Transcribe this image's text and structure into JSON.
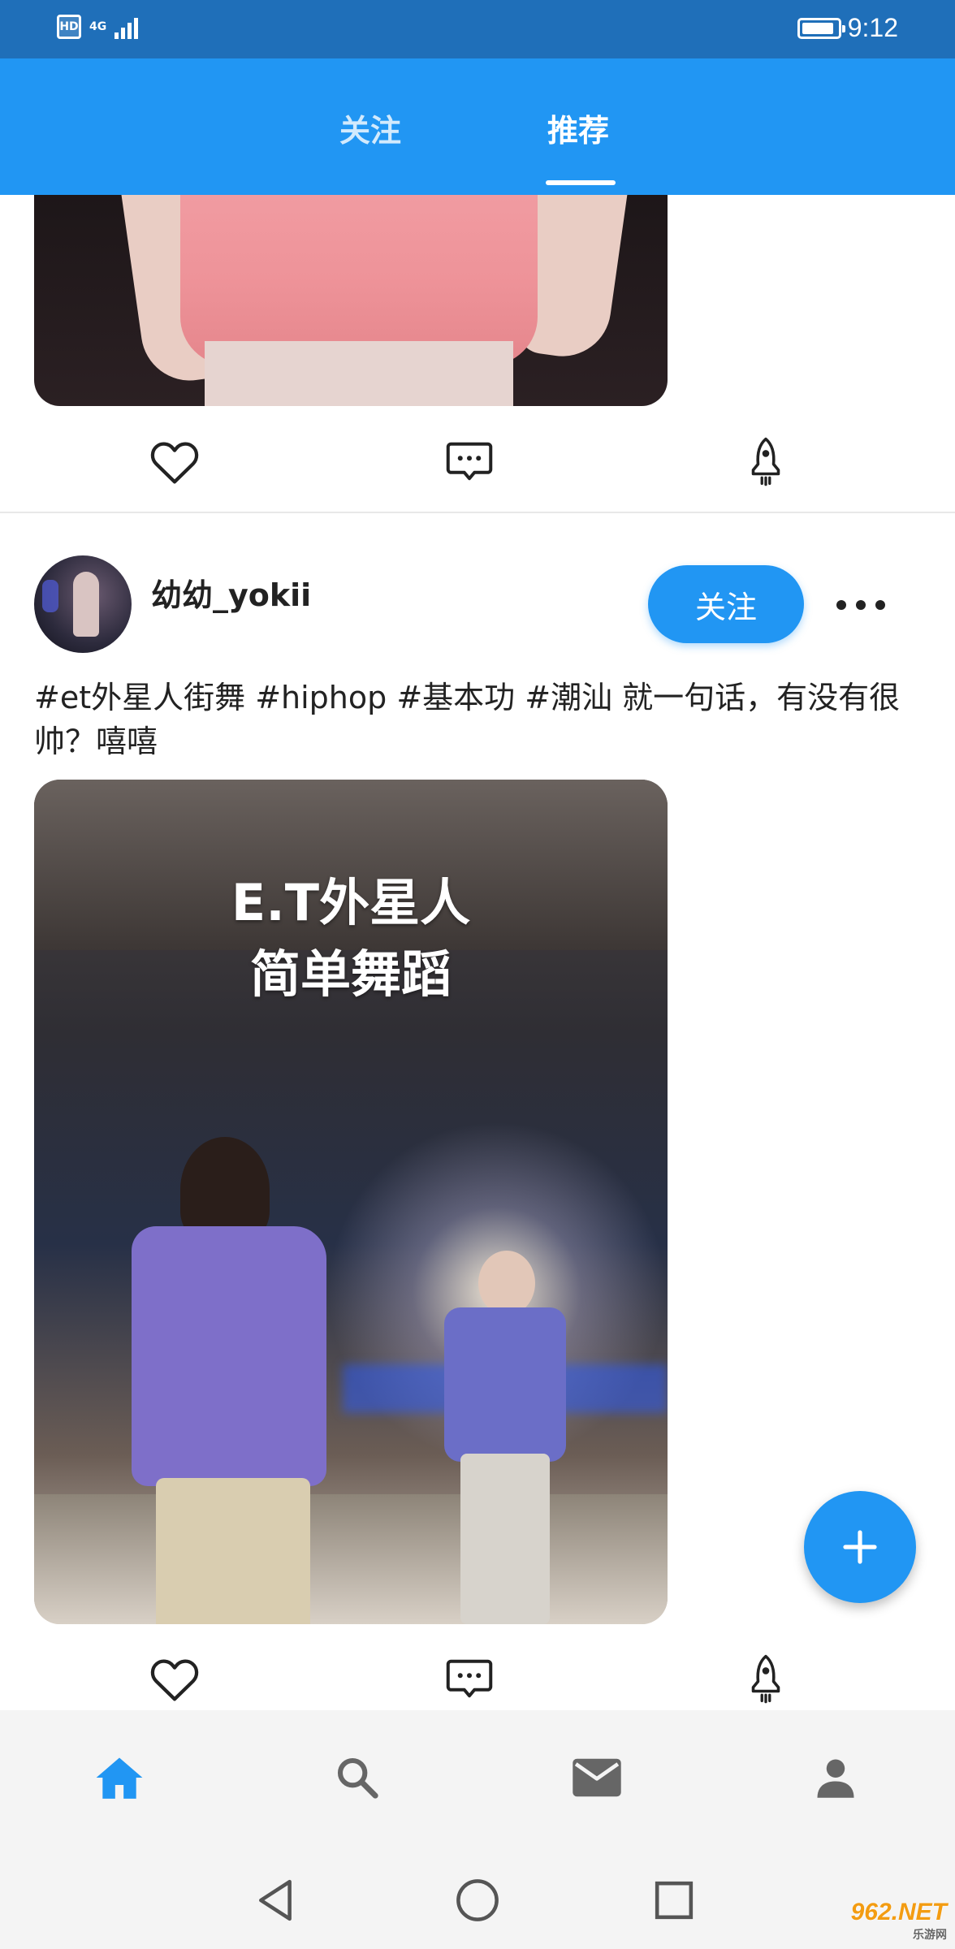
{
  "status_bar": {
    "hd_label": "HD",
    "network": "4G",
    "time": "9:12",
    "battery_level": 0.9
  },
  "header": {
    "tabs": [
      {
        "label": "关注",
        "active": false
      },
      {
        "label": "推荐",
        "active": true
      }
    ],
    "background": "#2196f3"
  },
  "feed": {
    "posts": [
      {
        "actions": {
          "like_icon": "heart-outline-icon",
          "comment_icon": "comment-bubble-icon",
          "boost_icon": "rocket-icon"
        }
      },
      {
        "username": "幼幼_yokii",
        "follow_label": "关注",
        "text": "#et外星人街舞 #hiphop #基本功   #潮汕 就一句话，有没有很帅？嘻嘻",
        "video_overlay": {
          "line1": "E.T外星人",
          "line2": "简单舞蹈"
        },
        "actions": {
          "like_icon": "heart-outline-icon",
          "comment_icon": "comment-bubble-icon",
          "boost_icon": "rocket-icon"
        }
      }
    ]
  },
  "fab": {
    "icon": "plus-icon"
  },
  "bottom_nav": {
    "items": [
      {
        "icon": "home-icon",
        "active": true
      },
      {
        "icon": "search-icon",
        "active": false
      },
      {
        "icon": "mail-icon",
        "active": false
      },
      {
        "icon": "person-icon",
        "active": false
      }
    ],
    "active_color": "#2196f3",
    "inactive_color": "#666666"
  },
  "watermark": {
    "brand": "962.NET",
    "sub": "乐游网"
  }
}
